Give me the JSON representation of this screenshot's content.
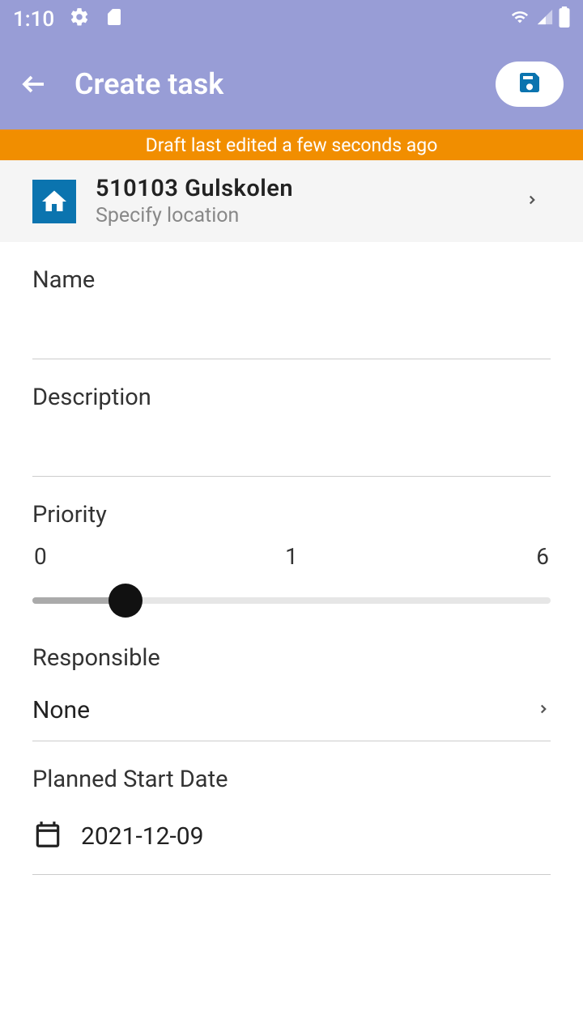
{
  "status": {
    "time": "1:10"
  },
  "header": {
    "title": "Create task"
  },
  "draft_banner": "Draft last edited a few seconds ago",
  "location": {
    "title": "510103 Gulskolen",
    "subtitle": "Specify location"
  },
  "form": {
    "name_label": "Name",
    "name_value": "",
    "description_label": "Description",
    "description_value": "",
    "priority_label": "Priority",
    "priority_min": "0",
    "priority_current": "1",
    "priority_max": "6",
    "priority_fill_percent": 18,
    "responsible_label": "Responsible",
    "responsible_value": "None",
    "planned_date_label": "Planned Start Date",
    "planned_date_value": "2021-12-09"
  }
}
